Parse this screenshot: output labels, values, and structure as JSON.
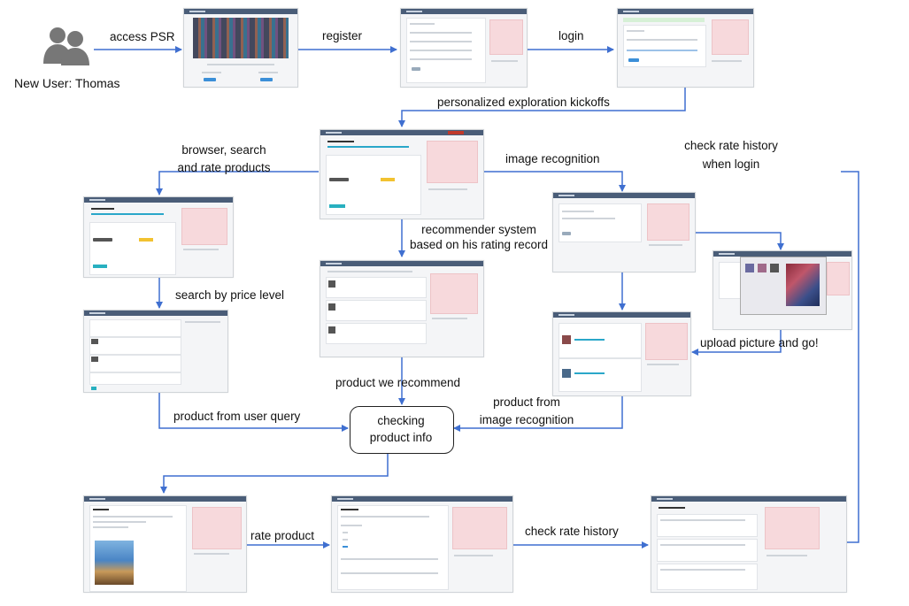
{
  "actor": {
    "label": "New User: Thomas",
    "icon": "users-icon"
  },
  "center_node": {
    "line1": "checking",
    "line2": "product info"
  },
  "edges": {
    "access": "access PSR",
    "register": "register",
    "login": "login",
    "kickoff": "personalized exploration kickoffs",
    "browse_1": "browser, search",
    "browse_2": "and rate products",
    "image_rec": "image recognition",
    "history_1": "check rate history",
    "history_2": "when login",
    "recsys_1": "recommender system",
    "recsys_2": "based on his rating record",
    "price": "search by price level",
    "upload": "upload picture and go!",
    "we_recommend": "product we recommend",
    "from_query": "product from user query",
    "from_image_1": "product from",
    "from_image_2": "image recognition",
    "rate": "rate product",
    "check_history": "check rate history"
  },
  "colors": {
    "arrow": "#3f6fd0",
    "header": "#4a5d78",
    "pink": "#f7d9dc"
  }
}
